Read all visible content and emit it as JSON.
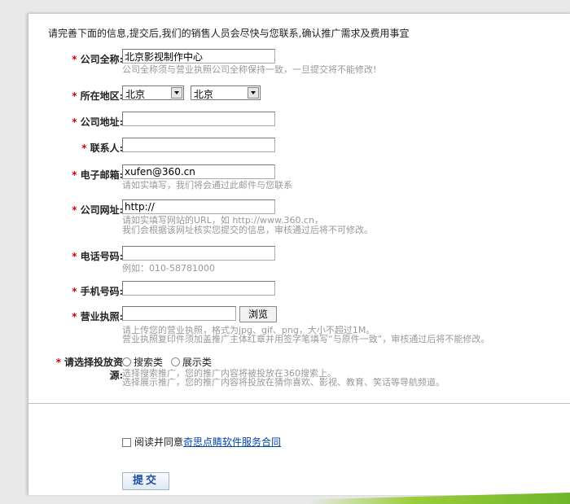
{
  "intro": "请完善下面的信息,提交后,我们的销售人员会尽快与您联系,确认推广需求及费用事宜",
  "required_mark": "*",
  "fields": {
    "company_name": {
      "label": "公司全称:",
      "value": "北京影视制作中心",
      "hint": "公司全称须与营业执照公司全称保持一致，一旦提交将不能修改!"
    },
    "region": {
      "label": "所在地区:",
      "province": "北京",
      "city": "北京"
    },
    "address": {
      "label": "公司地址:",
      "value": ""
    },
    "contact": {
      "label": "联系人:",
      "value": ""
    },
    "email": {
      "label": "电子邮箱:",
      "value": "xufen@360.cn",
      "hint": "请如实填写，我们将会通过此邮件与您联系"
    },
    "website": {
      "label": "公司网址:",
      "value": "http://",
      "hint1": "请如实填写网站的URL，如 http://www.360.cn，",
      "hint2": "我们会根据该网址核实您提交的信息，审核通过后将不可修改。"
    },
    "phone": {
      "label": "电话号码:",
      "value": "",
      "hint": "例如：010-58781000"
    },
    "mobile": {
      "label": "手机号码:",
      "value": ""
    },
    "license": {
      "label": "营业执照:",
      "browse_label": "浏览",
      "hint1": "请上传您的营业执照，格式为jpg、gif、png，大小不超过1M。",
      "hint2": "营业执照复印件须加盖推广主体红章并用签字笔填写“与原件一致”，审核通过后将不能修改。"
    },
    "resource": {
      "label_line1": "请选择投放资",
      "label_line2": "源:",
      "option_search": "搜索类",
      "option_display": "展示类",
      "hint1": "选择搜索推广，您的推广内容将被投放在360搜索上。",
      "hint2": "选择展示推广，您的推广内容将投放在猜你喜欢、影视、教育、笑话等导航频道。"
    }
  },
  "agreement": {
    "prefix": "阅读并同意",
    "link": "奇思点睛软件服务合同"
  },
  "submit_label": "提交"
}
